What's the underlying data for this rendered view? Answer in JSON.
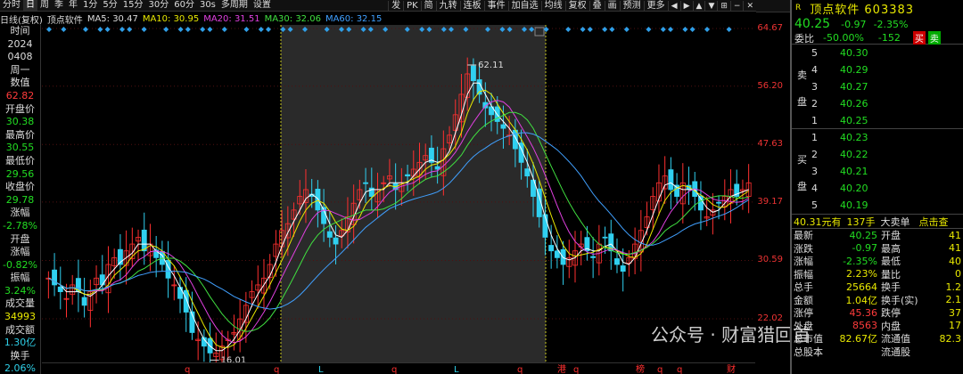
{
  "toolbar": {
    "items": [
      "分时",
      "日",
      "周",
      "季",
      "年",
      "1分",
      "5分",
      "15分",
      "30分",
      "60分",
      "30s",
      "多周期",
      "设置"
    ],
    "active": 1,
    "right_items": [
      "发",
      "PK",
      "简",
      "九转",
      "连板",
      "事件",
      "加自选",
      "均线",
      "复权",
      "叠",
      "画",
      "预测",
      "更多"
    ],
    "icons": [
      "◀",
      "▶",
      "▲",
      "▼",
      "⊞",
      "−",
      "✕"
    ]
  },
  "legend": {
    "period": "日线(复权)",
    "name": "顶点软件",
    "ma5_label": "MA5: 30.47",
    "ma10_label": "MA10: 30.95",
    "ma20_label": "MA20: 31.51",
    "ma30_label": "MA30: 32.06",
    "ma60_label": "MA60: 32.15"
  },
  "leftinfo": [
    {
      "t": "时间",
      "c": "wht"
    },
    {
      "t": "2024",
      "c": "wht"
    },
    {
      "t": "0408",
      "c": "wht"
    },
    {
      "t": "周一",
      "c": "wht"
    },
    {
      "t": "数值",
      "c": "wht"
    },
    {
      "t": "62.82",
      "c": "red"
    },
    {
      "t": "开盘价",
      "c": "wht"
    },
    {
      "t": "30.38",
      "c": "grn"
    },
    {
      "t": "最高价",
      "c": "wht"
    },
    {
      "t": "30.55",
      "c": "grn"
    },
    {
      "t": "最低价",
      "c": "wht"
    },
    {
      "t": "29.56",
      "c": "grn"
    },
    {
      "t": "收盘价",
      "c": "wht"
    },
    {
      "t": "29.78",
      "c": "grn"
    },
    {
      "t": "涨幅",
      "c": "wht"
    },
    {
      "t": "-2.78%",
      "c": "grn"
    },
    {
      "t": "开盘",
      "c": "wht"
    },
    {
      "t": "涨幅",
      "c": "wht"
    },
    {
      "t": "-0.82%",
      "c": "grn"
    },
    {
      "t": "振幅",
      "c": "wht"
    },
    {
      "t": "3.24%",
      "c": "grn"
    },
    {
      "t": "成交量",
      "c": "wht"
    },
    {
      "t": "34993",
      "c": "yel"
    },
    {
      "t": "成交额",
      "c": "wht"
    },
    {
      "t": "1.30亿",
      "c": "cy"
    },
    {
      "t": "换手",
      "c": "wht"
    },
    {
      "t": "2.06%",
      "c": "cy"
    }
  ],
  "chart_data": {
    "type": "candlestick",
    "yticks": [
      "64.67",
      "56.20",
      "47.63",
      "39.17",
      "30.59",
      "22.02"
    ],
    "ylim": [
      22.02,
      64.67
    ],
    "high_label": "62.11",
    "low_label": "16.01",
    "closes": [
      28,
      27,
      26,
      25,
      27,
      26,
      24,
      26,
      28,
      27,
      30,
      31,
      30,
      32,
      33,
      34,
      32,
      33,
      31,
      30,
      28,
      27,
      25,
      23,
      20,
      19,
      18,
      17,
      17,
      18,
      19,
      20,
      22,
      24,
      26,
      27,
      28,
      30,
      33,
      35,
      36,
      38,
      40,
      41,
      40,
      38,
      36,
      34,
      33,
      35,
      37,
      39,
      41,
      42,
      40,
      41,
      42,
      43,
      41,
      42,
      43,
      44,
      45,
      46,
      45,
      44,
      47,
      49,
      52,
      55,
      58,
      57,
      55,
      53,
      52,
      51,
      50,
      49,
      47,
      45,
      43,
      40,
      37,
      34,
      32,
      31,
      30,
      31,
      32,
      33,
      32,
      31,
      33,
      34,
      32,
      30,
      29,
      31,
      33,
      35,
      37,
      40,
      42,
      43,
      41,
      40,
      42,
      41,
      40,
      38,
      37,
      38,
      39,
      40,
      41,
      40,
      41,
      42
    ]
  },
  "markers_left": [
    "q",
    "q",
    "L",
    "q",
    "L",
    "q"
  ],
  "markers_right": [
    "港",
    "q",
    "榜",
    "q",
    "q",
    "财"
  ],
  "rp": {
    "code_label": "R",
    "title": "顶点软件 603383",
    "price": "40.25",
    "change": "-0.97",
    "pct": "-2.35%",
    "committee_label": "委比",
    "committee_pct": "-50.00%",
    "committee_diff": "-152",
    "buy_btn": "买",
    "sell_btn": "卖",
    "sell_label_1": "卖",
    "sell_label_2": "盘",
    "buy_label_1": "买",
    "buy_label_2": "盘",
    "asks": [
      {
        "n": "5",
        "p": "40.30"
      },
      {
        "n": "4",
        "p": "40.29"
      },
      {
        "n": "3",
        "p": "40.27"
      },
      {
        "n": "2",
        "p": "40.26"
      },
      {
        "n": "1",
        "p": "40.25"
      }
    ],
    "bids": [
      {
        "n": "1",
        "p": "40.23"
      },
      {
        "n": "2",
        "p": "40.22"
      },
      {
        "n": "3",
        "p": "40.21"
      },
      {
        "n": "4",
        "p": "40.20"
      },
      {
        "n": "5",
        "p": "40.19"
      }
    ],
    "trade": {
      "price": "40.31元有",
      "vol": "137手",
      "type": "大卖单",
      "extra": "点击查"
    },
    "stats": [
      {
        "l": "最新",
        "v": "40.25",
        "c": "grn",
        "l2": "开盘",
        "v2": "41"
      },
      {
        "l": "涨跌",
        "v": "-0.97",
        "c": "grn",
        "l2": "最高",
        "v2": "41"
      },
      {
        "l": "涨幅",
        "v": "-2.35%",
        "c": "grn",
        "l2": "最低",
        "v2": "40"
      },
      {
        "l": "振幅",
        "v": "2.23%",
        "c": "yel",
        "l2": "量比",
        "v2": "0"
      },
      {
        "l": "总手",
        "v": "25664",
        "c": "yel",
        "l2": "换手",
        "v2": "1.2"
      },
      {
        "l": "金额",
        "v": "1.04亿",
        "c": "yel",
        "l2": "换手(实)",
        "v2": "2.1"
      },
      {
        "l": "涨停",
        "v": "45.36",
        "c": "red",
        "l2": "跌停",
        "v2": "37"
      },
      {
        "l": "外盘",
        "v": "8563",
        "c": "red",
        "l2": "内盘",
        "v2": "17"
      },
      {
        "l": "总市值",
        "v": "82.67亿",
        "c": "yel",
        "l2": "流通值",
        "v2": "82.3"
      },
      {
        "l": "总股本",
        "v": "",
        "c": "yel",
        "l2": "流通股",
        "v2": ""
      }
    ]
  },
  "watermark": "公众号 · 财富猎回首"
}
